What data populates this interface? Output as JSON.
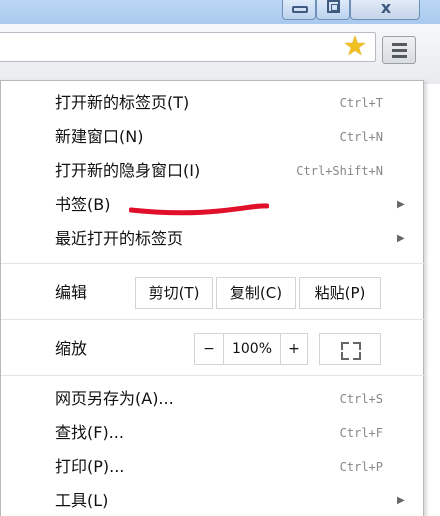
{
  "window_controls": {
    "close_glyph": "x"
  },
  "toolbar": {
    "star_glyph": "★"
  },
  "menu": {
    "group1": [
      {
        "label": "打开新的标签页(T)",
        "shortcut": "Ctrl+T"
      },
      {
        "label": "新建窗口(N)",
        "shortcut": "Ctrl+N"
      },
      {
        "label": "打开新的隐身窗口(I)",
        "shortcut": "Ctrl+Shift+N"
      },
      {
        "label": "书签(B)",
        "arrow": "▶"
      },
      {
        "label": "最近打开的标签页",
        "arrow": "▶"
      }
    ],
    "edit": {
      "label": "编辑",
      "cut": "剪切(T)",
      "copy": "复制(C)",
      "paste": "粘贴(P)"
    },
    "zoom": {
      "label": "缩放",
      "minus": "−",
      "value": "100%",
      "plus": "+"
    },
    "group2": [
      {
        "label": "网页另存为(A)...",
        "shortcut": "Ctrl+S"
      },
      {
        "label": "查找(F)...",
        "shortcut": "Ctrl+F"
      },
      {
        "label": "打印(P)...",
        "shortcut": "Ctrl+P"
      },
      {
        "label": "工具(L)",
        "arrow": "▶"
      }
    ]
  },
  "colors": {
    "scribble": "#e0102a",
    "star": "#f0c020"
  }
}
